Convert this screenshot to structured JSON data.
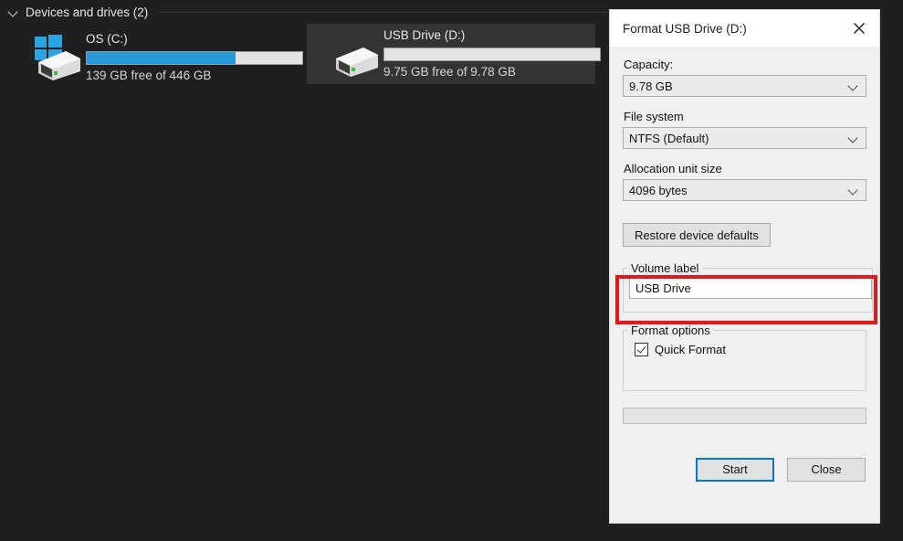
{
  "explorer": {
    "group_header": {
      "label": "Devices and drives (2)",
      "chevron_icon": "chevron-down-icon"
    },
    "drives": [
      {
        "name": "OS (C:)",
        "icon": "hard-drive-windows-icon",
        "free_text": "139 GB free of 446 GB",
        "used_percent": 69,
        "selected": false,
        "bar_color": "#2699d6"
      },
      {
        "name": "USB Drive (D:)",
        "icon": "usb-hard-drive-icon",
        "free_text": "9.75 GB free of 9.78 GB",
        "used_percent": 0,
        "selected": true,
        "bar_color": "#2699d6"
      }
    ]
  },
  "dialog": {
    "title": "Format USB Drive (D:)",
    "close_icon": "close-icon",
    "capacity": {
      "label": "Capacity:",
      "value": "9.78 GB",
      "arrow_icon": "chevron-down-icon"
    },
    "file_system": {
      "label": "File system",
      "value": "NTFS (Default)",
      "arrow_icon": "chevron-down-icon"
    },
    "allocation_unit": {
      "label": "Allocation unit size",
      "value": "4096 bytes",
      "arrow_icon": "chevron-down-icon"
    },
    "restore_defaults_label": "Restore device defaults",
    "volume_label": {
      "legend": "Volume label",
      "value": "USB Drive",
      "placeholder": ""
    },
    "format_options": {
      "legend": "Format options",
      "quick_format": {
        "label": "Quick Format",
        "checked": true
      }
    },
    "progress": {
      "percent": 0
    },
    "start_label": "Start",
    "close_label": "Close"
  },
  "annotation": {
    "highlight_color": "#e81616",
    "target": "volume-label-group"
  }
}
